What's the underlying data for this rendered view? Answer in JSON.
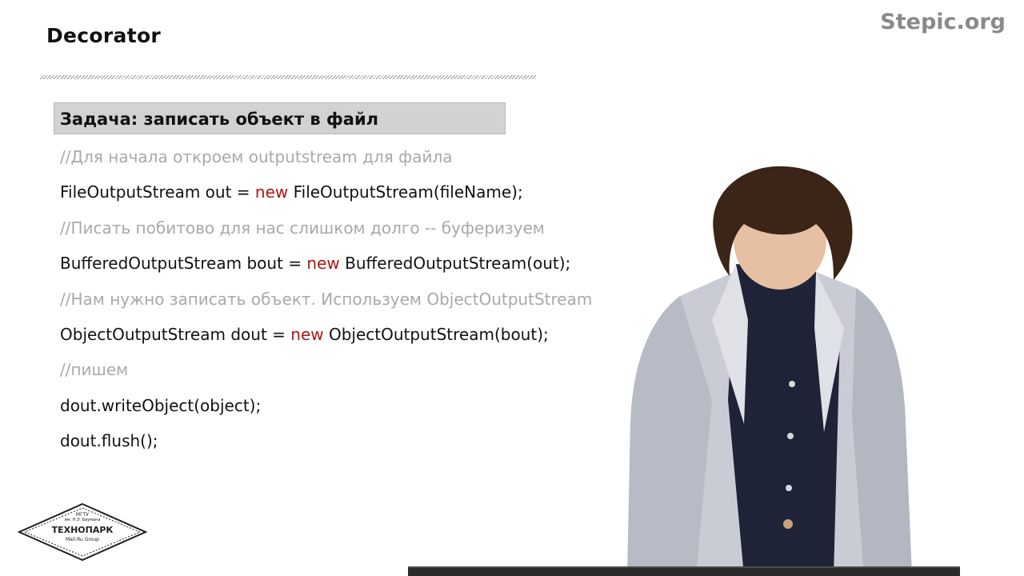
{
  "slide": {
    "title": "Decorator",
    "brand": "Stepic.org"
  },
  "task": {
    "heading": "Задача: записать объект в файл"
  },
  "code_lines": [
    {
      "kind": "comment",
      "text": "//Для начала откроем outputstream для файла"
    },
    {
      "kind": "stmt",
      "pre": "FileOutputStream out = ",
      "kw": "new",
      "post": " FileOutputStream(fileName);"
    },
    {
      "kind": "comment",
      "text": "//Писать побитово для нас слишком долго -- буферизуем"
    },
    {
      "kind": "stmt",
      "pre": "BufferedOutputStream bout = ",
      "kw": "new",
      "post": " BufferedOutputStream(out);"
    },
    {
      "kind": "comment",
      "text": "//Нам нужно записать объект. Используем ObjectOutputStream"
    },
    {
      "kind": "stmt",
      "pre": "ObjectOutputStream dout = ",
      "kw": "new",
      "post": " ObjectOutputStream(bout);"
    },
    {
      "kind": "comment",
      "text": "//пишем"
    },
    {
      "kind": "stmt",
      "pre": "dout.writeObject(object);",
      "kw": "",
      "post": ""
    },
    {
      "kind": "stmt",
      "pre": "dout.flush();",
      "kw": "",
      "post": ""
    }
  ],
  "logo": {
    "line1": "МГТУ",
    "line2": "им. Н.Э. Баумана",
    "line3": "ТЕХНОПАРК",
    "line4": "Mail.Ru Group"
  },
  "colors": {
    "keyword": "#b01414",
    "comment": "#a9a9a9",
    "text": "#111111",
    "task_box": "#d2d2d2",
    "brand": "#8a8a8a"
  },
  "icons": {
    "logo": "technopark-logo",
    "presenter": "presenter-photo"
  }
}
